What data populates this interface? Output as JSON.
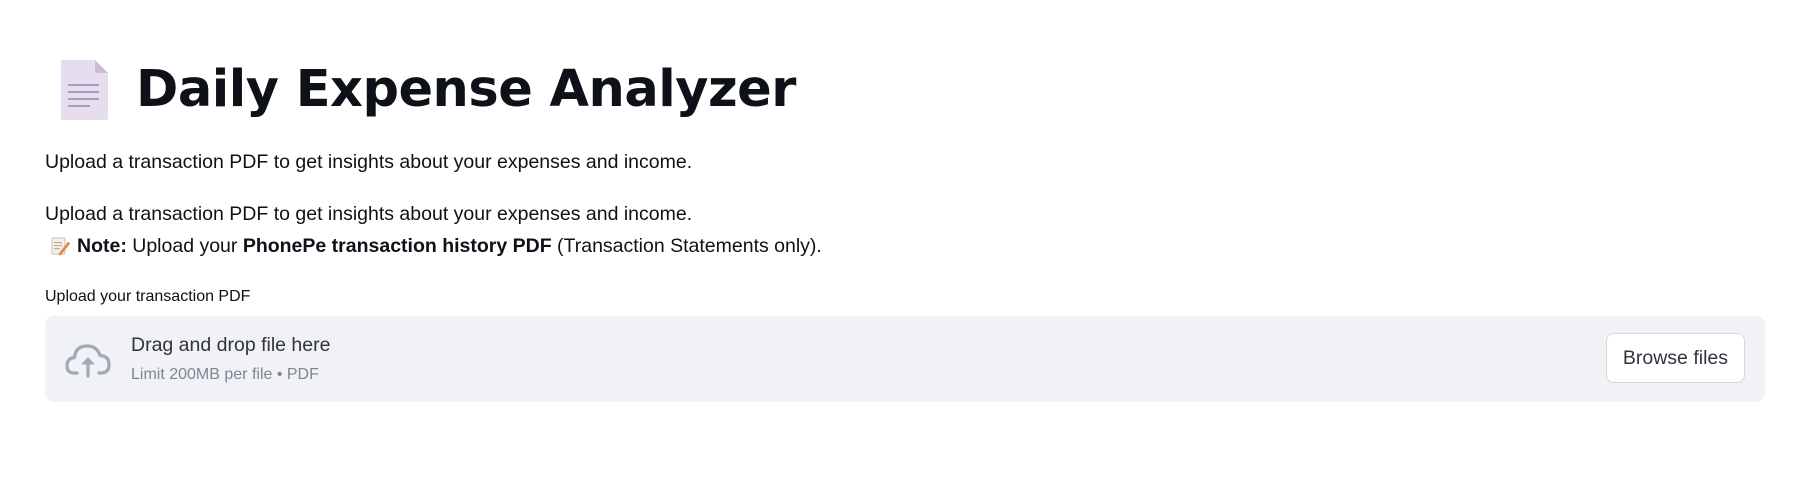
{
  "header": {
    "icon": "page-document-icon",
    "title": "Daily Expense Analyzer"
  },
  "intro": {
    "line1": "Upload a transaction PDF to get insights about your expenses and income.",
    "line2": "Upload a transaction PDF to get insights about your expenses and income."
  },
  "note": {
    "icon": "memo-icon",
    "label": "Note:",
    "text_before": " Upload your ",
    "emphasis": "PhonePe transaction history PDF",
    "text_after": " (Transaction Statements only)."
  },
  "uploader": {
    "label": "Upload your transaction PDF",
    "icon": "cloud-upload-icon",
    "drop_title": "Drag and drop file here",
    "drop_limit": "Limit 200MB per file • PDF",
    "browse_label": "Browse files"
  },
  "colors": {
    "dropzone_bg": "#f0f2f6",
    "cloud_icon": "#a3a8b8",
    "title_text": "#0e1117",
    "muted_text": "#808495"
  }
}
